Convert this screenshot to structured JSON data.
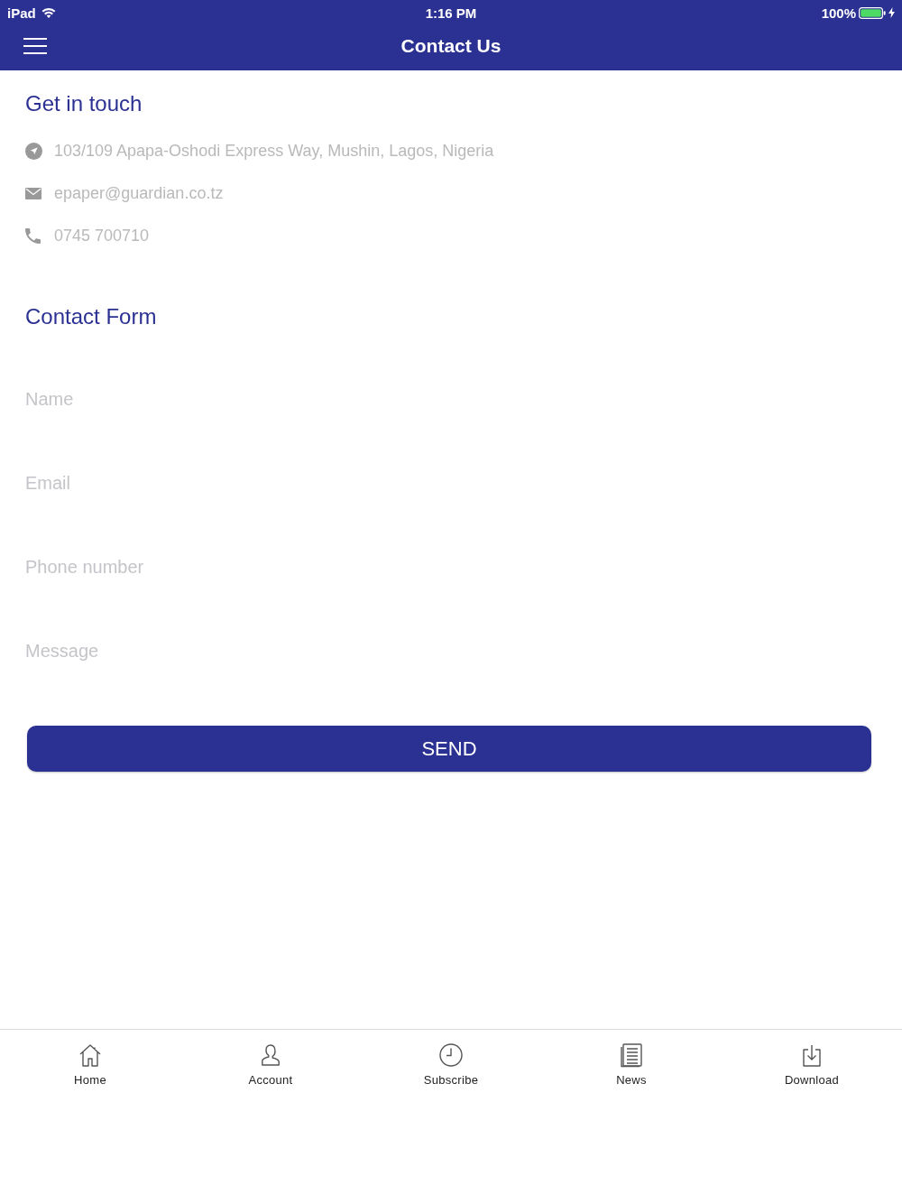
{
  "status_bar": {
    "device": "iPad",
    "time": "1:16 PM",
    "battery": "100%"
  },
  "nav_bar": {
    "title": "Contact Us"
  },
  "contact_info": {
    "heading": "Get in touch",
    "items": [
      {
        "kind": "address",
        "text": "103/109 Apapa-Oshodi Express Way, Mushin, Lagos, Nigeria"
      },
      {
        "kind": "email",
        "text": "epaper@guardian.co.tz"
      },
      {
        "kind": "phone",
        "text": "0745 700710"
      }
    ]
  },
  "contact_form": {
    "heading": "Contact Form",
    "fields": [
      {
        "placeholder": "Name"
      },
      {
        "placeholder": "Email"
      },
      {
        "placeholder": "Phone number"
      },
      {
        "placeholder": "Message"
      }
    ],
    "submit": "SEND"
  },
  "tab_bar": [
    {
      "kind": "home",
      "label": "Home"
    },
    {
      "kind": "account",
      "label": "Account"
    },
    {
      "kind": "subscribe",
      "label": "Subscribe"
    },
    {
      "kind": "news",
      "label": "News"
    },
    {
      "kind": "download",
      "label": "Download"
    }
  ]
}
